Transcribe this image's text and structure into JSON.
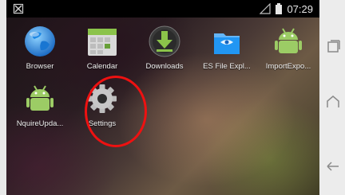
{
  "statusbar": {
    "time": "07:29",
    "left_icon": "no-sim-icon",
    "right_icons": [
      "signal-icon",
      "battery-icon"
    ]
  },
  "apps": [
    {
      "label": "Browser",
      "icon": "globe-icon"
    },
    {
      "label": "Calendar",
      "icon": "calendar-icon"
    },
    {
      "label": "Downloads",
      "icon": "download-icon"
    },
    {
      "label": "ES File Expl...",
      "icon": "es-file-explorer-icon"
    },
    {
      "label": "ImportExpo...",
      "icon": "android-icon"
    },
    {
      "label": "NquireUpda...",
      "icon": "android-icon"
    },
    {
      "label": "Settings",
      "icon": "gear-icon"
    }
  ],
  "highlight": {
    "target": "Settings",
    "color": "#e11111"
  },
  "navbar": {
    "buttons": [
      "recent-apps-icon",
      "home-icon",
      "back-icon"
    ]
  }
}
